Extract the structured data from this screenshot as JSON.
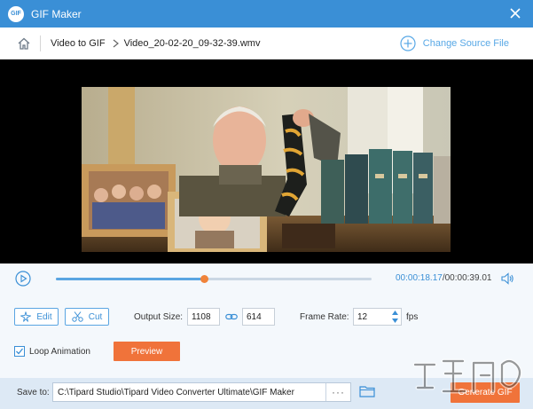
{
  "window": {
    "logo_text": "GIF",
    "title": "GIF Maker"
  },
  "breadcrumb": {
    "section": "Video to GIF",
    "file": "Video_20-02-20_09-32-39.wmv",
    "change_source": "Change Source File"
  },
  "playback": {
    "current_time": "00:00:18.17",
    "separator": "/",
    "total_time": "00:00:39.01",
    "progress": 0.47
  },
  "edit": {
    "edit_label": "Edit",
    "cut_label": "Cut",
    "output_size_label": "Output Size:",
    "width": "1108",
    "height": "614",
    "frame_rate_label": "Frame Rate:",
    "frame_rate": "12",
    "fps_label": "fps"
  },
  "options": {
    "loop_label": "Loop Animation",
    "loop_checked": true,
    "preview_label": "Preview"
  },
  "footer": {
    "save_label": "Save to:",
    "save_path": "C:\\Tipard Studio\\Tipard Video Converter Ultimate\\GIF Maker",
    "browse_label": "···",
    "generate_label": "Generate GIF"
  },
  "colors": {
    "titlebar": "#3a8fd6",
    "accent": "#5aa5e2",
    "action": "#f0733a",
    "footer": "#dde9f5"
  },
  "icons": [
    "home-icon",
    "chevron-right-icon",
    "add-circle-icon",
    "close-icon",
    "play-icon",
    "volume-icon",
    "edit-icon",
    "scissors-icon",
    "link-icon",
    "checkmark-icon",
    "folder-icon"
  ]
}
